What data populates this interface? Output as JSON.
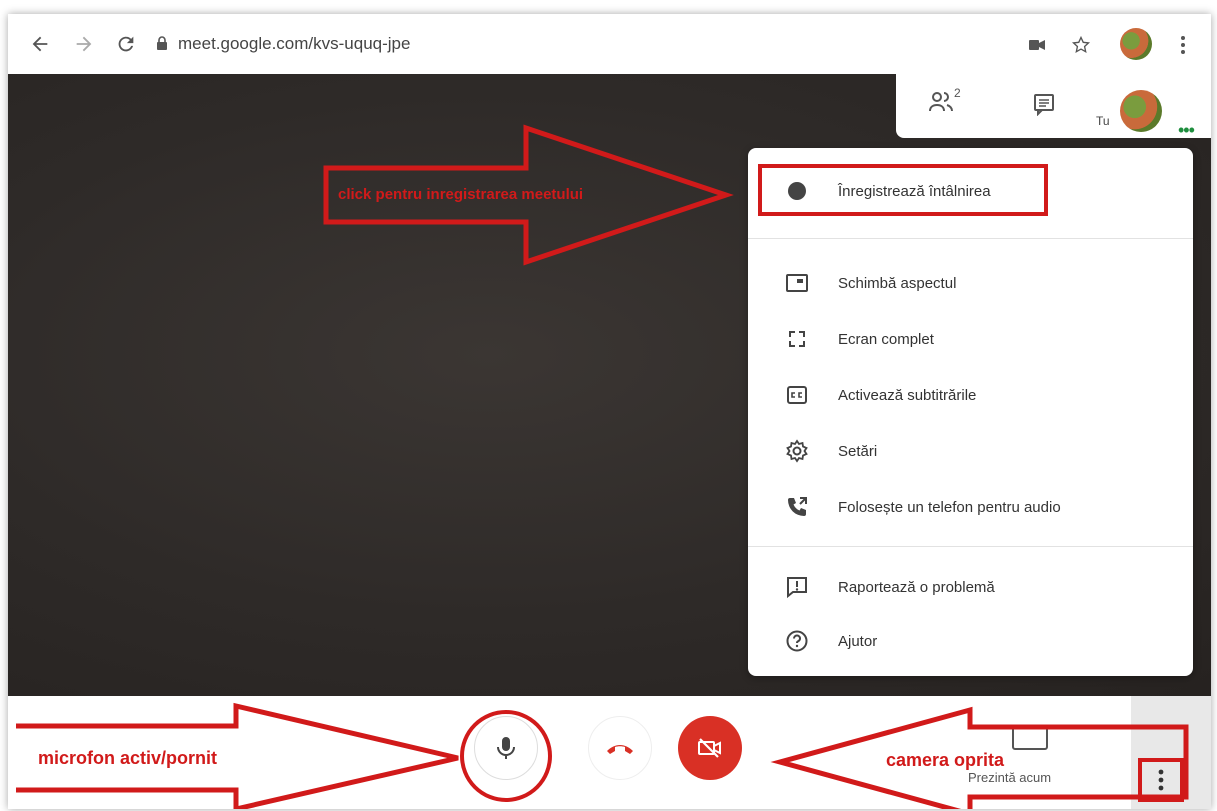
{
  "browser": {
    "url": "meet.google.com/kvs-uquq-jpe",
    "back_icon": "arrow-left-icon",
    "forward_icon": "arrow-right-icon",
    "reload_icon": "reload-icon"
  },
  "meet": {
    "people_count": "2",
    "self_label": "Tu",
    "menu_items": [
      {
        "label": "Înregistrează întâlnirea",
        "icon": "record-icon"
      },
      {
        "label": "Schimbă aspectul",
        "icon": "layout-icon"
      },
      {
        "label": "Ecran complet",
        "icon": "fullscreen-icon"
      },
      {
        "label": "Activează subtitrările",
        "icon": "captions-icon"
      },
      {
        "label": "Setări",
        "icon": "settings-icon"
      },
      {
        "label": "Folosește un telefon pentru audio",
        "icon": "phone-audio-icon"
      },
      {
        "label": "Raportează o problemă",
        "icon": "report-icon"
      },
      {
        "label": "Ajutor",
        "icon": "help-icon"
      }
    ],
    "present_label": "Prezintă acum"
  },
  "annotations": {
    "record_hint": "click pentru inregistrarea meetului",
    "mic_hint": "microfon activ/pornit",
    "camera_hint": "camera oprita"
  },
  "colors": {
    "annotation_red": "#d11a1a",
    "camera_off_red": "#d93025",
    "video_bg": "#2e2a28"
  }
}
